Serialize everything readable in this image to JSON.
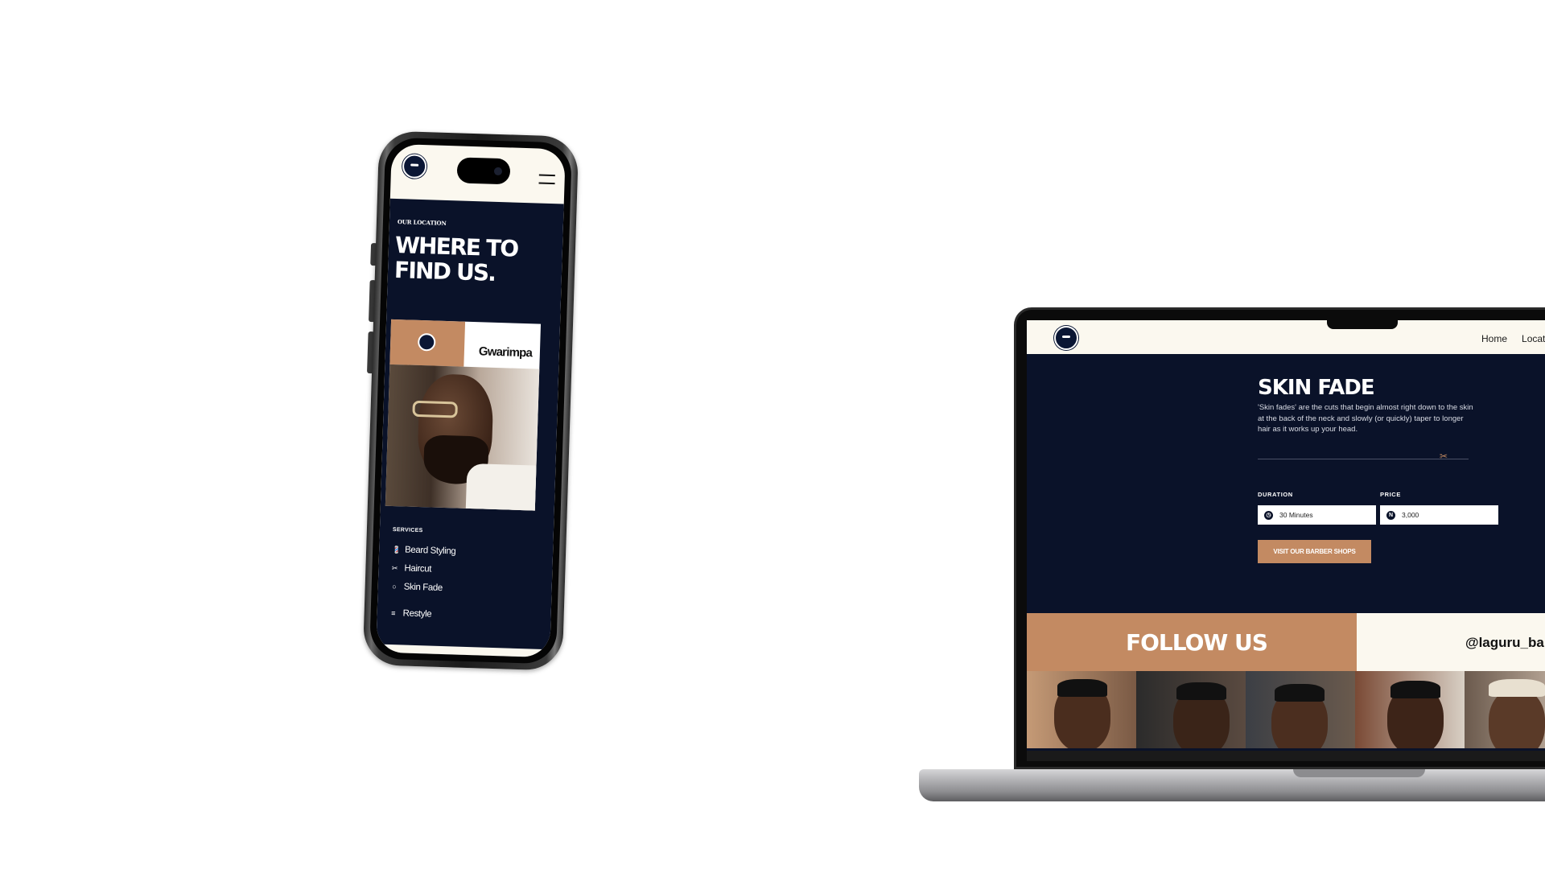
{
  "mobile": {
    "eyebrow": "OUR LOCATION",
    "title": "WHERE TO FIND US.",
    "location_name": "Gwarimpa",
    "services_label": "SERVICES",
    "services": [
      {
        "label": "Beard Styling",
        "icon": "beard-icon"
      },
      {
        "label": "Haircut",
        "icon": "scissors-icon"
      },
      {
        "label": "Skin Fade",
        "icon": "head-icon"
      },
      {
        "label": "Restyle",
        "icon": "comb-icon"
      }
    ]
  },
  "desktop": {
    "nav": [
      "Home",
      "Locat"
    ],
    "hero": {
      "title": "SKIN FADE",
      "description": "'Skin fades' are the cuts that begin almost right down to the skin at the back of the neck and slowly (or quickly) taper to longer hair as it works up your head."
    },
    "duration_label": "DURATION",
    "duration_value": "30 Minutes",
    "price_label": "PRICE",
    "price_value": "3,000",
    "price_currency_symbol": "N",
    "cta_label": "VISIT OUR BARBER SHOPS",
    "follow_title": "FOLLOW US",
    "follow_handle": "@laguru_ba"
  },
  "colors": {
    "navy": "#0a1229",
    "tan": "#c38a62",
    "cream": "#fbf8ef"
  }
}
